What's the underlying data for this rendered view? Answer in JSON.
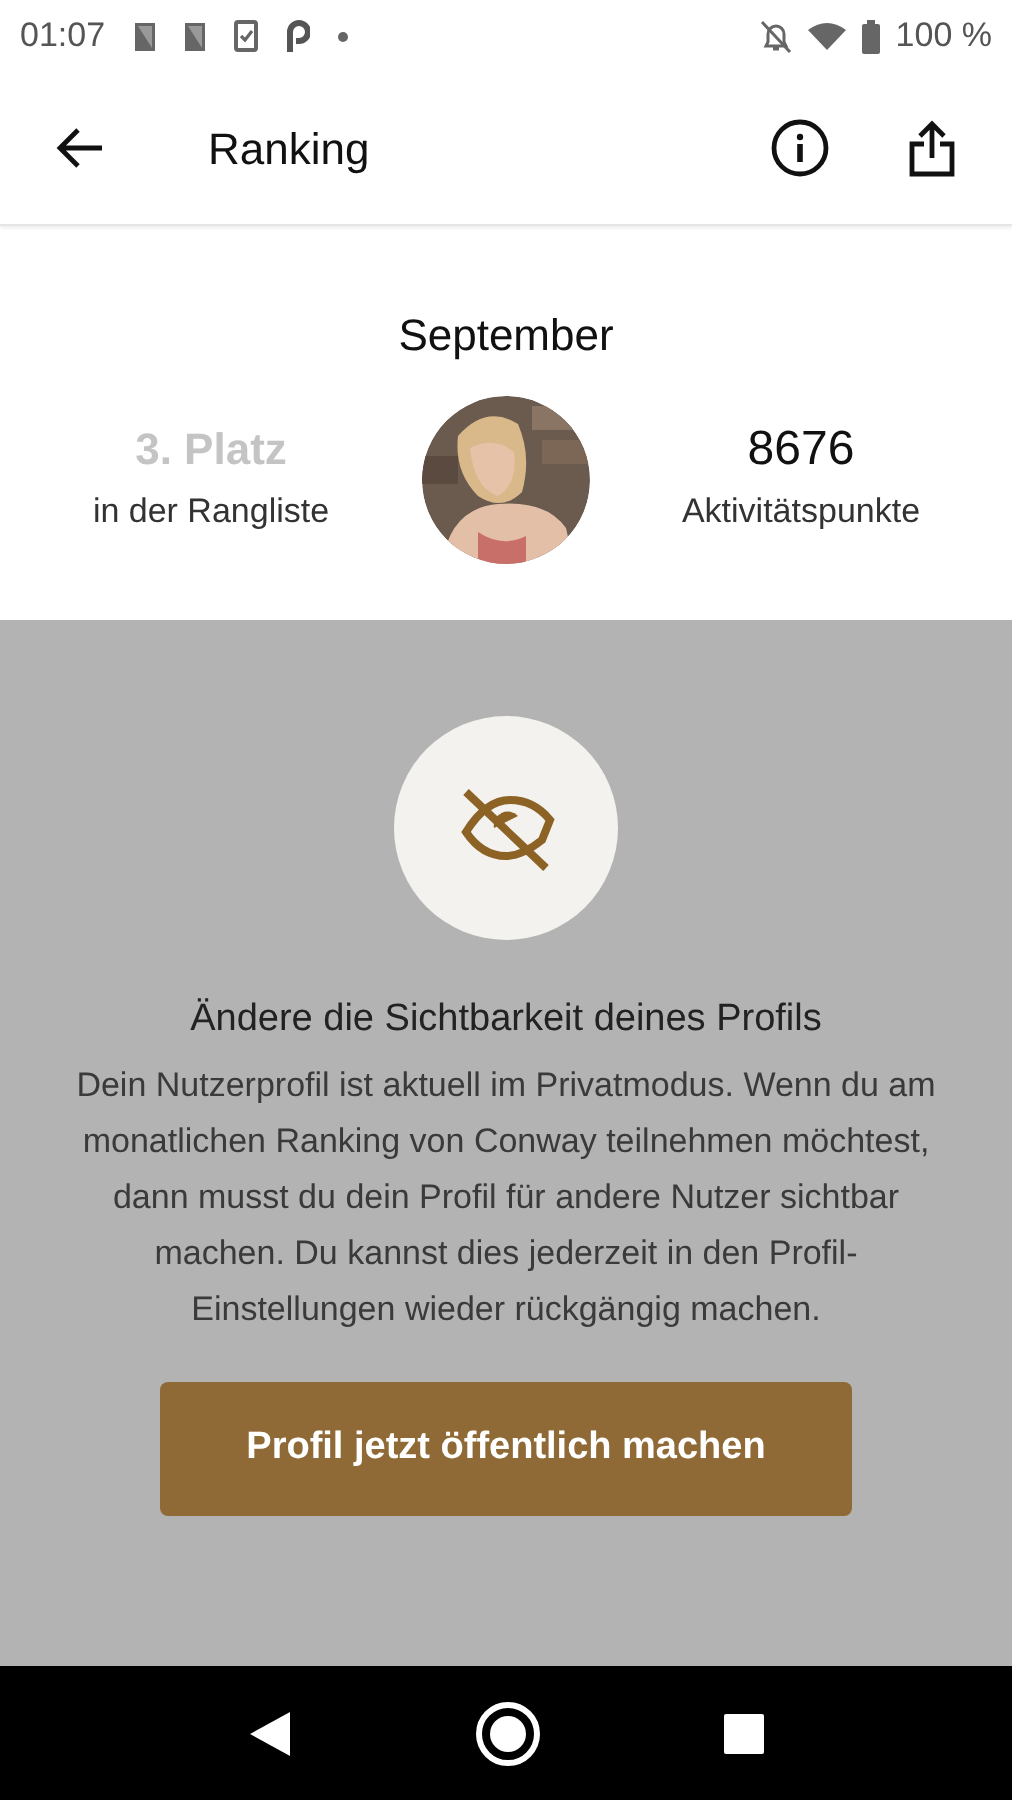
{
  "status_bar": {
    "time": "01:07",
    "battery": "100 %"
  },
  "app_bar": {
    "title": "Ranking"
  },
  "summary": {
    "month": "September",
    "rank": "3. Platz",
    "rank_label": "in der Rangliste",
    "points": "8676",
    "points_label": "Aktivitätspunkte"
  },
  "dialog": {
    "title": "Ändere die Sichtbarkeit deines Profils",
    "body": "Dein Nutzerprofil ist aktuell im Privatmodus. Wenn du am monatlichen Ranking von Conway teilnehmen möchtest, dann musst du dein Profil für andere Nutzer sichtbar machen. Du kannst dies jederzeit in den Profil-Einstellungen wieder rückgängig machen.",
    "button": "Profil jetzt öffentlich machen"
  }
}
